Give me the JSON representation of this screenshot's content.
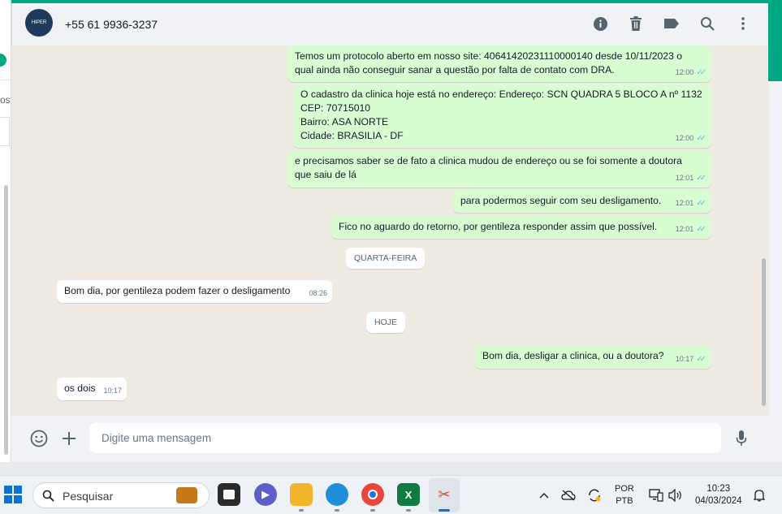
{
  "contact": {
    "name": "+55 61 9936-3237",
    "avatar_text": "HIPER"
  },
  "left_panel": {
    "cut_text": "os"
  },
  "header_icons": [
    "info-icon",
    "trash-icon",
    "label-icon",
    "search-icon",
    "more-icon"
  ],
  "messages": [
    {
      "text": "Temos um protocolo aberto em nosso site: 40641420231110000140 desde 10/11/2023 o\nqual ainda não conseguir sanar a questão por falta de contato com DRA.",
      "time": "12:00",
      "dir": "out"
    },
    {
      "text": "O cadastro da clinica hoje está no endereço: Endereço: SCN QUADRA 5 BLOCO A nº 1132\nCEP: 70715010\nBairro: ASA NORTE\nCidade: BRASILIA - DF",
      "time": "12:00",
      "dir": "out"
    },
    {
      "text": "e precisamos saber se de fato a clinica mudou de endereço ou se foi somente a doutora\nque saiu de lá",
      "time": "12:01",
      "dir": "out"
    },
    {
      "text": "para podermos seguir com seu desligamento.",
      "time": "12:01",
      "dir": "out"
    },
    {
      "text": "Fico no aguardo do retorno, por gentileza responder assim que possível.",
      "time": "12:01",
      "dir": "out"
    },
    {
      "text": "Bom dia, por gentileza podem fazer o desligamento",
      "time": "08:26",
      "dir": "in"
    },
    {
      "text": "Bom dia, desligar a clinica, ou a doutora?",
      "time": "10:17",
      "dir": "out"
    },
    {
      "text": "os dois",
      "time": "10:17",
      "dir": "in"
    }
  ],
  "day_chips": [
    "QUARTA-FEIRA",
    "HOJE"
  ],
  "composer": {
    "placeholder": "Digite uma mensagem"
  },
  "taskbar": {
    "search_label": "Pesquisar",
    "lang_top": "POR",
    "lang_bottom": "PTB",
    "time": "10:23",
    "date": "04/03/2024"
  },
  "colors": {
    "accent": "#00a884",
    "outgoing": "#d9fdd3",
    "incoming": "#ffffff",
    "read_ticks": "#53bdeb"
  }
}
